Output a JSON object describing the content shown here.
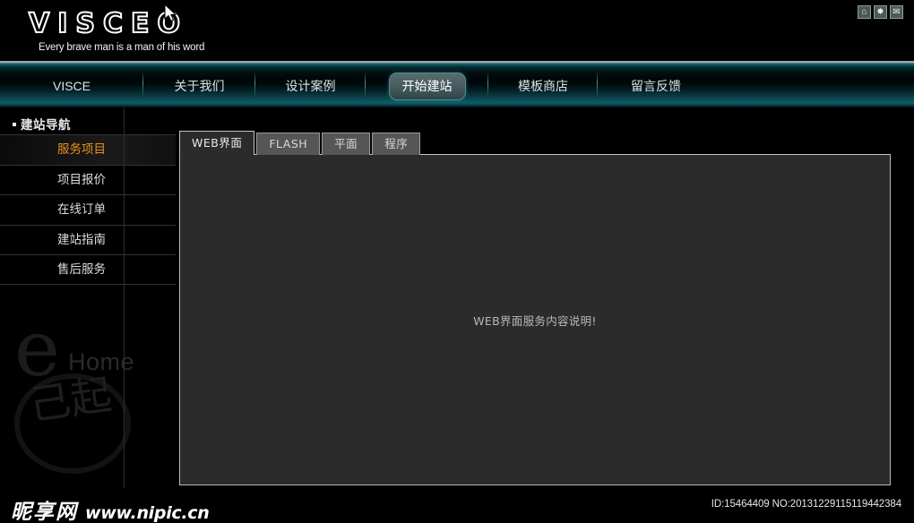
{
  "header": {
    "logo_word": "VISCEO",
    "tagline": "Every brave man is a man of his word",
    "icons": [
      {
        "name": "home-icon",
        "glyph": "⌂"
      },
      {
        "name": "favorite-icon",
        "glyph": "✸"
      },
      {
        "name": "mail-icon",
        "glyph": "✉"
      }
    ]
  },
  "nav": {
    "items": [
      {
        "label": "VISCE",
        "active": false
      },
      {
        "label": "关于我们",
        "active": false
      },
      {
        "label": "设计案例",
        "active": false
      },
      {
        "label": "开始建站",
        "active": true
      },
      {
        "label": "模板商店",
        "active": false
      },
      {
        "label": "留言反馈",
        "active": false
      }
    ]
  },
  "sidebar": {
    "title": "建站导航",
    "items": [
      {
        "label": "服务项目",
        "active": true
      },
      {
        "label": "项目报价",
        "active": false
      },
      {
        "label": "在线订单",
        "active": false
      },
      {
        "label": "建站指南",
        "active": false
      },
      {
        "label": "售后服务",
        "active": false
      }
    ],
    "logo": {
      "letter": "e",
      "word": "Home",
      "seal": "己起"
    }
  },
  "main": {
    "tabs": [
      {
        "label": "WEB界面",
        "active": true
      },
      {
        "label": "FLASH",
        "active": false
      },
      {
        "label": "平面",
        "active": false
      },
      {
        "label": "程序",
        "active": false
      }
    ],
    "content_text": "WEB界面服务内容说明!"
  },
  "footer": {
    "id_text": "ID:15464409 NO:20131229115119442384"
  },
  "watermark": {
    "site_cn": "昵享网",
    "site_url": "www.nipic.cn"
  },
  "colors": {
    "background": "#000000",
    "nav_accent": "#0d5e69",
    "nav_top_line": "#9aa8ae",
    "sidebar_active": "#e8911b",
    "panel_bg": "#2b2b2b",
    "panel_border": "#b9b9b9",
    "tab_inactive": "#565656",
    "text_light": "#d9e4e6"
  }
}
